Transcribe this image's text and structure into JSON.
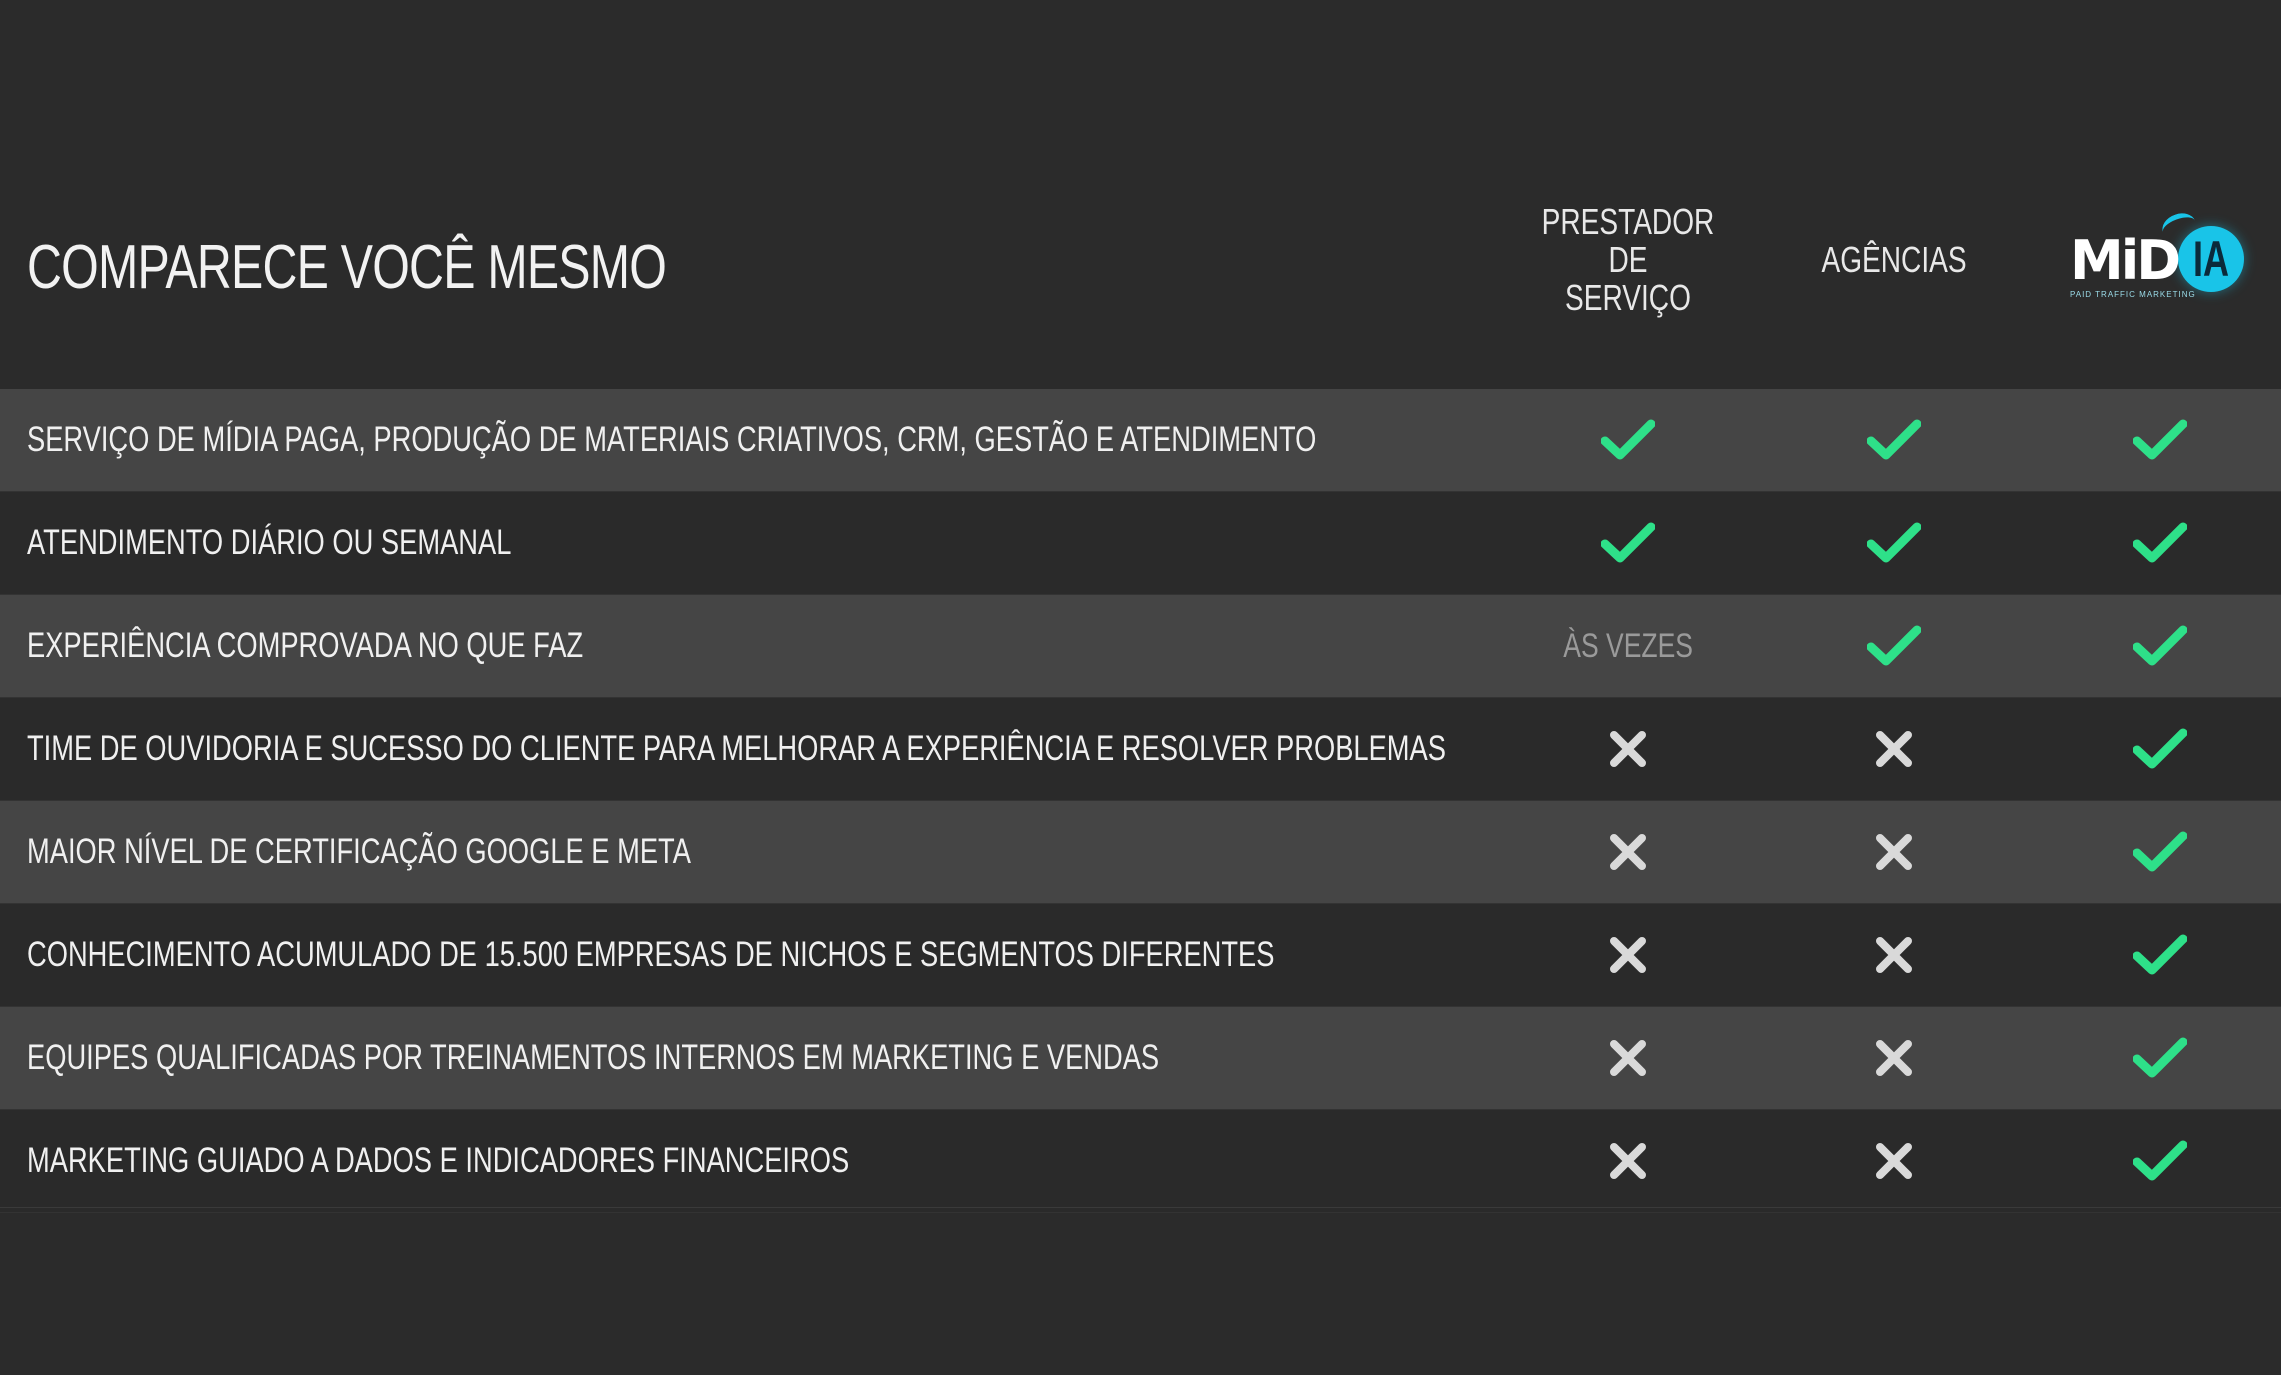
{
  "title": "COMPARECE VOCÊ MESMO",
  "columns": [
    {
      "label": "PRESTADOR DE\nSERVIÇO"
    },
    {
      "label": "AGÊNCIAS"
    },
    {
      "label": "MIDIA",
      "logo_text_main": "MiD",
      "logo_text_accent": "IA",
      "logo_tagline": "PAID TRAFFIC MARKETING"
    }
  ],
  "colors": {
    "background": "#2b2b2b",
    "row_light": "#454545",
    "row_dark": "#2a2a2a",
    "check": "#2ee089",
    "cross": "#d9d9d9",
    "brand_accent": "#19c4e8"
  },
  "rows": [
    {
      "label": "SERVIÇO DE MÍDIA PAGA, PRODUÇÃO DE MATERIAIS CRIATIVOS, CRM, GESTÃO E ATENDIMENTO",
      "values": [
        "check",
        "check",
        "check"
      ]
    },
    {
      "label": "ATENDIMENTO DIÁRIO OU SEMANAL",
      "values": [
        "check",
        "check",
        "check"
      ]
    },
    {
      "label": "EXPERIÊNCIA COMPROVADA NO QUE FAZ",
      "values": [
        "text:ÀS VEZES",
        "check",
        "check"
      ]
    },
    {
      "label": "TIME DE OUVIDORIA E SUCESSO DO CLIENTE PARA MELHORAR A EXPERIÊNCIA E RESOLVER PROBLEMAS",
      "values": [
        "cross",
        "cross",
        "check"
      ]
    },
    {
      "label": "MAIOR NÍVEL DE CERTIFICAÇÃO GOOGLE E META",
      "values": [
        "cross",
        "cross",
        "check"
      ]
    },
    {
      "label": "CONHECIMENTO ACUMULADO DE 15.500 EMPRESAS DE NICHOS E SEGMENTOS DIFERENTES",
      "values": [
        "cross",
        "cross",
        "check"
      ]
    },
    {
      "label": "EQUIPES QUALIFICADAS POR TREINAMENTOS INTERNOS EM MARKETING E VENDAS",
      "values": [
        "cross",
        "cross",
        "check"
      ]
    },
    {
      "label": "MARKETING GUIADO A DADOS E INDICADORES FINANCEIROS",
      "values": [
        "cross",
        "cross",
        "check"
      ]
    }
  ]
}
